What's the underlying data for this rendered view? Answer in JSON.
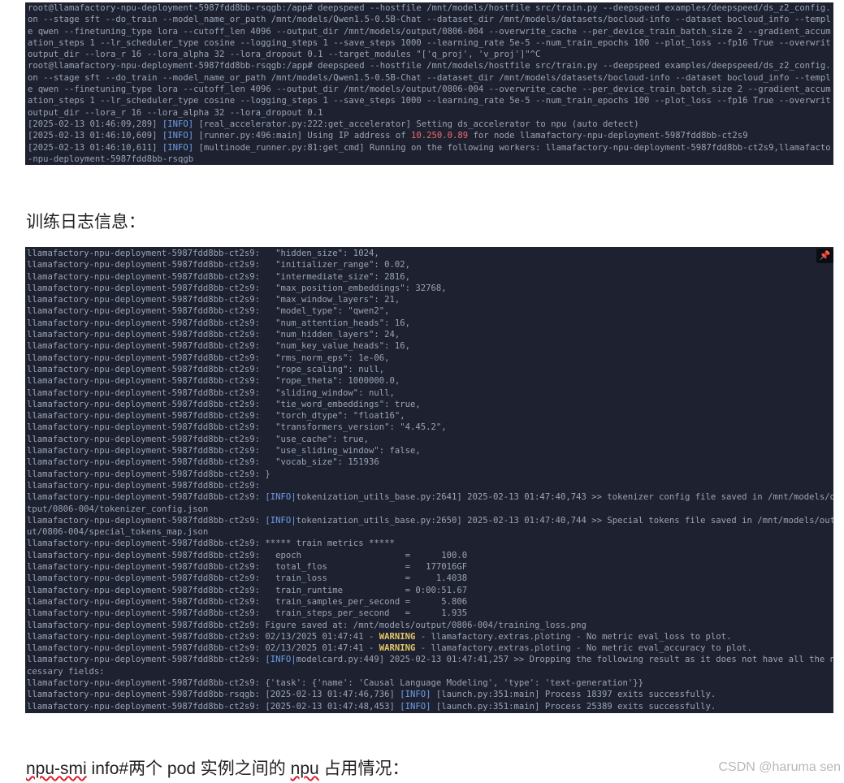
{
  "terminal_top": {
    "lines": [
      [
        {
          "t": "root@llamafactory-npu-deployment-5987fdd8bb-rsqgb:/app# deepspeed --hostfile /mnt/models/hostfile src/train.py --deepspeed examples/deepspeed/ds_z2_config.js"
        }
      ],
      [
        {
          "t": "on --stage sft --do_train --model_name_or_path /mnt/models/Qwen1.5-0.5B-Chat --dataset_dir /mnt/models/datasets/bocloud-info --dataset bocloud_info --templat"
        }
      ],
      [
        {
          "t": "e qwen --finetuning_type lora --cutoff_len 4096 --output_dir /mnt/models/output/0806-004 --overwrite_cache --per_device_train_batch_size 2 --gradient_accumul"
        }
      ],
      [
        {
          "t": "ation_steps 1 --lr_scheduler_type cosine --logging_steps 1 --save_steps 1000 --learning_rate 5e-5 --num_train_epochs 100 --plot_loss --fp16 True --overwrite_"
        }
      ],
      [
        {
          "t": "output_dir --lora_r 16 --lora_alpha 32 --lora_dropout 0.1 --target_modules \"['q_proj', 'v_proj']\"^C"
        }
      ],
      [
        {
          "t": "root@llamafactory-npu-deployment-5987fdd8bb-rsqgb:/app# deepspeed --hostfile /mnt/models/hostfile src/train.py --deepspeed examples/deepspeed/ds_z2_config.js"
        }
      ],
      [
        {
          "t": "on --stage sft --do_train --model_name_or_path /mnt/models/Qwen1.5-0.5B-Chat --dataset_dir /mnt/models/datasets/bocloud-info --dataset bocloud_info --templat"
        }
      ],
      [
        {
          "t": "e qwen --finetuning_type lora --cutoff_len 4096 --output_dir /mnt/models/output/0806-004 --overwrite_cache --per_device_train_batch_size 2 --gradient_accumul"
        }
      ],
      [
        {
          "t": "ation_steps 1 --lr_scheduler_type cosine --logging_steps 1 --save_steps 1000 --learning_rate 5e-5 --num_train_epochs 100 --plot_loss --fp16 True --overwrite_"
        }
      ],
      [
        {
          "t": "output_dir --lora_r 16 --lora_alpha 32 --lora_dropout 0.1"
        }
      ],
      [
        {
          "t": "[2025-02-13 01:46:09,289] "
        },
        {
          "t": "[INFO]",
          "c": "c-info"
        },
        {
          "t": " [real_accelerator.py:222:get_accelerator] Setting ds_accelerator to npu (auto detect)"
        }
      ],
      [
        {
          "t": "[2025-02-13 01:46:10,609] "
        },
        {
          "t": "[INFO]",
          "c": "c-info"
        },
        {
          "t": " [runner.py:496:main] Using IP address of "
        },
        {
          "t": "10.250.0.89",
          "c": "c-ip"
        },
        {
          "t": " for node llamafactory-npu-deployment-5987fdd8bb-ct2s9"
        }
      ],
      [
        {
          "t": "[2025-02-13 01:46:10,611] "
        },
        {
          "t": "[INFO]",
          "c": "c-info"
        },
        {
          "t": " [multinode_runner.py:81:get_cmd] Running on the following workers: llamafactory-npu-deployment-5987fdd8bb-ct2s9,llamafactory"
        }
      ],
      [
        {
          "t": "-npu-deployment-5987fdd8bb-rsqgb"
        }
      ]
    ]
  },
  "heading_text": "训练日志信息：",
  "terminal_bottom": {
    "corner_icon": "pin-icon",
    "lines": [
      [
        {
          "t": "llamafactory-npu-deployment-5987fdd8bb-ct2s9:   \"hidden_size\": 1024,"
        }
      ],
      [
        {
          "t": "llamafactory-npu-deployment-5987fdd8bb-ct2s9:   \"initializer_range\": 0.02,"
        }
      ],
      [
        {
          "t": "llamafactory-npu-deployment-5987fdd8bb-ct2s9:   \"intermediate_size\": 2816,"
        }
      ],
      [
        {
          "t": "llamafactory-npu-deployment-5987fdd8bb-ct2s9:   \"max_position_embeddings\": 32768,"
        }
      ],
      [
        {
          "t": "llamafactory-npu-deployment-5987fdd8bb-ct2s9:   \"max_window_layers\": 21,"
        }
      ],
      [
        {
          "t": "llamafactory-npu-deployment-5987fdd8bb-ct2s9:   \"model_type\": \"qwen2\","
        }
      ],
      [
        {
          "t": "llamafactory-npu-deployment-5987fdd8bb-ct2s9:   \"num_attention_heads\": 16,"
        }
      ],
      [
        {
          "t": "llamafactory-npu-deployment-5987fdd8bb-ct2s9:   \"num_hidden_layers\": 24,"
        }
      ],
      [
        {
          "t": "llamafactory-npu-deployment-5987fdd8bb-ct2s9:   \"num_key_value_heads\": 16,"
        }
      ],
      [
        {
          "t": "llamafactory-npu-deployment-5987fdd8bb-ct2s9:   \"rms_norm_eps\": 1e-06,"
        }
      ],
      [
        {
          "t": "llamafactory-npu-deployment-5987fdd8bb-ct2s9:   \"rope_scaling\": null,"
        }
      ],
      [
        {
          "t": "llamafactory-npu-deployment-5987fdd8bb-ct2s9:   \"rope_theta\": 1000000.0,"
        }
      ],
      [
        {
          "t": "llamafactory-npu-deployment-5987fdd8bb-ct2s9:   \"sliding_window\": null,"
        }
      ],
      [
        {
          "t": "llamafactory-npu-deployment-5987fdd8bb-ct2s9:   \"tie_word_embeddings\": true,"
        }
      ],
      [
        {
          "t": "llamafactory-npu-deployment-5987fdd8bb-ct2s9:   \"torch_dtype\": \"float16\","
        }
      ],
      [
        {
          "t": "llamafactory-npu-deployment-5987fdd8bb-ct2s9:   \"transformers_version\": \"4.45.2\","
        }
      ],
      [
        {
          "t": "llamafactory-npu-deployment-5987fdd8bb-ct2s9:   \"use_cache\": true,"
        }
      ],
      [
        {
          "t": "llamafactory-npu-deployment-5987fdd8bb-ct2s9:   \"use_sliding_window\": false,"
        }
      ],
      [
        {
          "t": "llamafactory-npu-deployment-5987fdd8bb-ct2s9:   \"vocab_size\": 151936"
        }
      ],
      [
        {
          "t": "llamafactory-npu-deployment-5987fdd8bb-ct2s9: }"
        }
      ],
      [
        {
          "t": "llamafactory-npu-deployment-5987fdd8bb-ct2s9:"
        }
      ],
      [
        {
          "t": "llamafactory-npu-deployment-5987fdd8bb-ct2s9: "
        },
        {
          "t": "[INFO|",
          "c": "c-info"
        },
        {
          "t": "tokenization_utils_base.py:2641] 2025-02-13 01:47:40,743 >> tokenizer config file saved in /mnt/models/ou"
        }
      ],
      [
        {
          "t": "tput/0806-004/tokenizer_config.json"
        }
      ],
      [
        {
          "t": "llamafactory-npu-deployment-5987fdd8bb-ct2s9: "
        },
        {
          "t": "[INFO|",
          "c": "c-info"
        },
        {
          "t": "tokenization_utils_base.py:2650] 2025-02-13 01:47:40,744 >> Special tokens file saved in /mnt/models/outp"
        }
      ],
      [
        {
          "t": "ut/0806-004/special_tokens_map.json"
        }
      ],
      [
        {
          "t": "llamafactory-npu-deployment-5987fdd8bb-ct2s9: ***** train metrics *****"
        }
      ],
      [
        {
          "t": "llamafactory-npu-deployment-5987fdd8bb-ct2s9:   epoch                    =      100.0"
        }
      ],
      [
        {
          "t": "llamafactory-npu-deployment-5987fdd8bb-ct2s9:   total_flos               =   177016GF"
        }
      ],
      [
        {
          "t": "llamafactory-npu-deployment-5987fdd8bb-ct2s9:   train_loss               =     1.4038"
        }
      ],
      [
        {
          "t": "llamafactory-npu-deployment-5987fdd8bb-ct2s9:   train_runtime            = 0:00:51.67"
        }
      ],
      [
        {
          "t": "llamafactory-npu-deployment-5987fdd8bb-ct2s9:   train_samples_per_second =      5.806"
        }
      ],
      [
        {
          "t": "llamafactory-npu-deployment-5987fdd8bb-ct2s9:   train_steps_per_second   =      1.935"
        }
      ],
      [
        {
          "t": "llamafactory-npu-deployment-5987fdd8bb-ct2s9: Figure saved at: /mnt/models/output/0806-004/training_loss.png"
        }
      ],
      [
        {
          "t": "llamafactory-npu-deployment-5987fdd8bb-ct2s9: 02/13/2025 01:47:41 - "
        },
        {
          "t": "WARNING",
          "c": "c-warn"
        },
        {
          "t": " - llamafactory.extras.ploting - No metric eval_loss to plot."
        }
      ],
      [
        {
          "t": "llamafactory-npu-deployment-5987fdd8bb-ct2s9: 02/13/2025 01:47:41 - "
        },
        {
          "t": "WARNING",
          "c": "c-warn"
        },
        {
          "t": " - llamafactory.extras.ploting - No metric eval_accuracy to plot."
        }
      ],
      [
        {
          "t": "llamafactory-npu-deployment-5987fdd8bb-ct2s9: "
        },
        {
          "t": "[INFO|",
          "c": "c-info"
        },
        {
          "t": "modelcard.py:449] 2025-02-13 01:47:41,257 >> Dropping the following result as it does not have all the ne"
        }
      ],
      [
        {
          "t": "cessary fields:"
        }
      ],
      [
        {
          "t": "llamafactory-npu-deployment-5987fdd8bb-ct2s9: {'task': {'name': 'Causal Language Modeling', 'type': 'text-generation'}}"
        }
      ],
      [
        {
          "t": "llamafactory-npu-deployment-5987fdd8bb-rsqgb: [2025-02-13 01:47:46,736] "
        },
        {
          "t": "[INFO]",
          "c": "c-info"
        },
        {
          "t": " [launch.py:351:main] Process 18397 exits successfully."
        }
      ],
      [
        {
          "t": "llamafactory-npu-deployment-5987fdd8bb-ct2s9: [2025-02-13 01:47:48,453] "
        },
        {
          "t": "[INFO]",
          "c": "c-info"
        },
        {
          "t": " [launch.py:351:main] Process 25389 exits successfully."
        }
      ]
    ]
  },
  "bottom_text": {
    "part1": "npu-smi",
    "part2": " info#两个 ",
    "part3": "pod",
    "part4": " 实例之间的 ",
    "part5": "npu",
    "part6": " 占用情况："
  },
  "watermark": "CSDN @haruma sen",
  "colors": {
    "terminal_bg": "#1e2230",
    "terminal_text": "#9aa3b6",
    "info": "#6e9eea",
    "ip": "#f06a6a",
    "warning": "#e6c66a"
  }
}
